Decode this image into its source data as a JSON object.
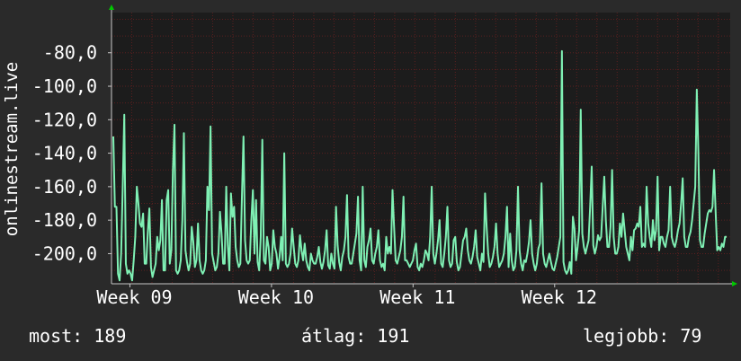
{
  "chart_data": {
    "type": "line",
    "ylabel": "onlinestream.live",
    "xlabel": "",
    "ylim": [
      -218,
      -56
    ],
    "yticks": [
      -80,
      -100,
      -120,
      -140,
      -160,
      -180,
      -200
    ],
    "ytick_labels": [
      "-80,0",
      "-100,0",
      "-120,0",
      "-140,0",
      "-160,0",
      "-180,0",
      "-200,0"
    ],
    "x_ticks": [
      {
        "label": "Week 09",
        "x": 9
      },
      {
        "label": "Week 10",
        "x": 10
      },
      {
        "label": "Week 11",
        "x": 11
      },
      {
        "label": "Week 12",
        "x": 12
      }
    ],
    "xlim": [
      8.87,
      13.24
    ],
    "grid": true,
    "colors": {
      "background": "#2a2a2a",
      "plot_background": "#1c1c1c",
      "grid": "#5a1f1f",
      "series": "#7ff0b4",
      "axis": "#c8c8c8",
      "arrow": "#00c800"
    },
    "series": [
      {
        "values": [
          -130,
          -172,
          -172,
          -212,
          -216,
          -200,
          -160,
          -117,
          -206,
          -212,
          -210,
          -212,
          -216,
          -204,
          -190,
          -160,
          -170,
          -182,
          -184,
          -176,
          -206,
          -206,
          -187,
          -173,
          -208,
          -214,
          -210,
          -206,
          -190,
          -198,
          -192,
          -168,
          -210,
          -210,
          -168,
          -162,
          -206,
          -198,
          -150,
          -123,
          -210,
          -212,
          -210,
          -204,
          -180,
          -128,
          -198,
          -205,
          -210,
          -206,
          -184,
          -193,
          -208,
          -204,
          -182,
          -204,
          -210,
          -212,
          -210,
          -204,
          -160,
          -174,
          -124,
          -200,
          -205,
          -210,
          -208,
          -200,
          -175,
          -188,
          -206,
          -206,
          -160,
          -195,
          -210,
          -164,
          -178,
          -172,
          -196,
          -204,
          -208,
          -206,
          -166,
          -130,
          -192,
          -204,
          -206,
          -204,
          -180,
          -162,
          -200,
          -168,
          -205,
          -210,
          -190,
          -132,
          -204,
          -206,
          -190,
          -196,
          -210,
          -206,
          -186,
          -196,
          -200,
          -209,
          -202,
          -190,
          -204,
          -140,
          -206,
          -208,
          -206,
          -200,
          -185,
          -196,
          -206,
          -208,
          -204,
          -189,
          -198,
          -204,
          -194,
          -204,
          -208,
          -210,
          -200,
          -204,
          -206,
          -206,
          -202,
          -196,
          -205,
          -209,
          -205,
          -198,
          -186,
          -207,
          -209,
          -200,
          -206,
          -209,
          -172,
          -195,
          -205,
          -210,
          -202,
          -198,
          -190,
          -165,
          -202,
          -206,
          -206,
          -200,
          -194,
          -188,
          -166,
          -204,
          -210,
          -160,
          -204,
          -208,
          -196,
          -192,
          -185,
          -204,
          -206,
          -200,
          -196,
          -186,
          -204,
          -208,
          -206,
          -210,
          -190,
          -200,
          -196,
          -200,
          -162,
          -184,
          -204,
          -206,
          -202,
          -198,
          -190,
          -166,
          -204,
          -204,
          -206,
          -208,
          -206,
          -204,
          -198,
          -194,
          -208,
          -210,
          -206,
          -208,
          -204,
          -198,
          -200,
          -204,
          -190,
          -160,
          -200,
          -206,
          -200,
          -192,
          -180,
          -206,
          -208,
          -200,
          -190,
          -172,
          -204,
          -208,
          -206,
          -192,
          -190,
          -205,
          -210,
          -208,
          -200,
          -192,
          -190,
          -185,
          -198,
          -204,
          -206,
          -202,
          -196,
          -186,
          -202,
          -206,
          -210,
          -200,
          -205,
          -164,
          -184,
          -200,
          -208,
          -206,
          -202,
          -196,
          -182,
          -200,
          -208,
          -206,
          -204,
          -200,
          -190,
          -172,
          -208,
          -188,
          -204,
          -210,
          -208,
          -198,
          -160,
          -198,
          -206,
          -210,
          -204,
          -205,
          -200,
          -193,
          -180,
          -200,
          -206,
          -210,
          -206,
          -197,
          -194,
          -158,
          -200,
          -206,
          -208,
          -204,
          -200,
          -205,
          -209,
          -210,
          -206,
          -202,
          -196,
          -190,
          -79,
          -205,
          -210,
          -212,
          -210,
          -205,
          -212,
          -178,
          -185,
          -204,
          -196,
          -186,
          -114,
          -188,
          -196,
          -200,
          -196,
          -192,
          -172,
          -148,
          -195,
          -200,
          -196,
          -189,
          -192,
          -190,
          -172,
          -154,
          -180,
          -196,
          -196,
          -184,
          -150,
          -190,
          -200,
          -200,
          -196,
          -182,
          -190,
          -176,
          -186,
          -196,
          -200,
          -204,
          -190,
          -198,
          -186,
          -185,
          -182,
          -184,
          -172,
          -196,
          -194,
          -196,
          -160,
          -182,
          -190,
          -196,
          -180,
          -192,
          -186,
          -154,
          -198,
          -190,
          -190,
          -194,
          -196,
          -190,
          -186,
          -160,
          -190,
          -194,
          -196,
          -192,
          -186,
          -182,
          -170,
          -155,
          -190,
          -196,
          -196,
          -190,
          -187,
          -180,
          -170,
          -160,
          -102,
          -140,
          -192,
          -196,
          -196,
          -188,
          -182,
          -176,
          -174,
          -175,
          -172,
          -150,
          -175,
          -198,
          -196,
          -198,
          -194,
          -196,
          -190,
          -190
        ]
      }
    ]
  },
  "legend": {
    "current": "most: 189",
    "average": "átlag: 191",
    "best": "legjobb: 79"
  }
}
